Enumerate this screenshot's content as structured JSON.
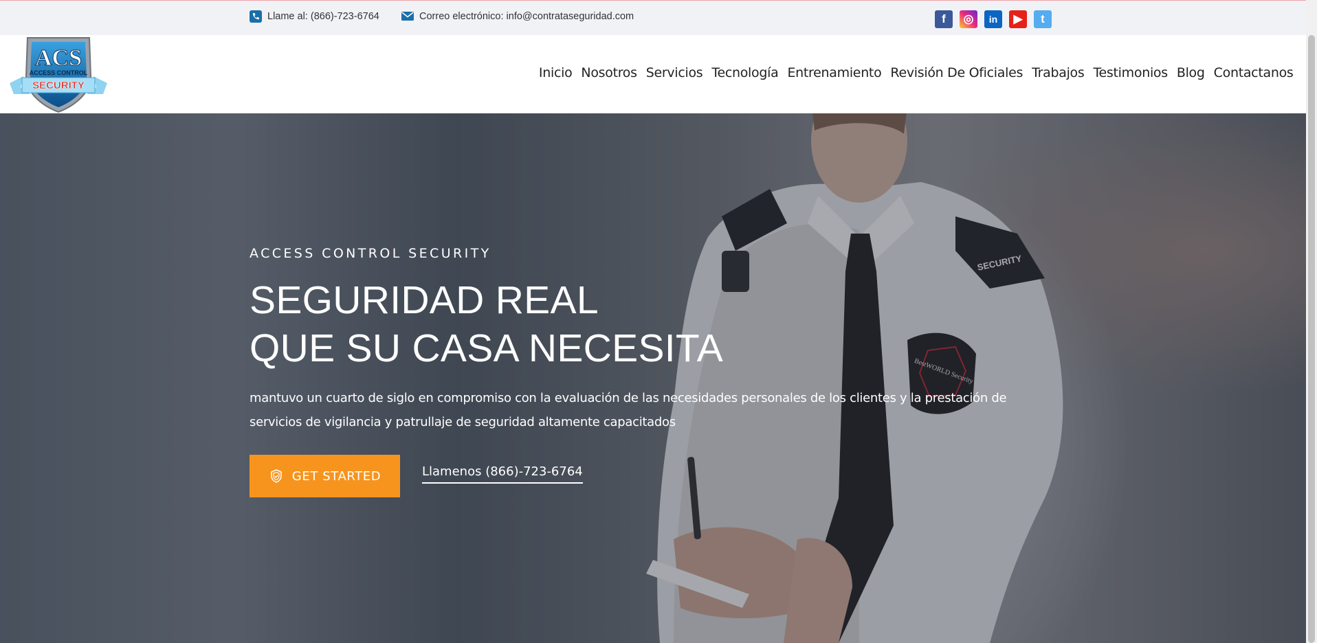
{
  "topbar": {
    "phone_text": "Llame al: (866)-723-6764",
    "email_text": "Correo electrónico: info@contrataseguridad.com",
    "social": [
      {
        "name": "facebook-icon",
        "glyph": "f"
      },
      {
        "name": "instagram-icon",
        "glyph": "◎"
      },
      {
        "name": "linkedin-icon",
        "glyph": "in"
      },
      {
        "name": "youtube-icon",
        "glyph": "▶"
      },
      {
        "name": "twitter-icon",
        "glyph": "t"
      }
    ]
  },
  "logo": {
    "text_big": "ACS",
    "text_line1": "ACCESS CONTROL",
    "text_line2": "SECURITY"
  },
  "nav": {
    "items": [
      "Inicio",
      "Nosotros",
      "Servicios",
      "Tecnología",
      "Entrenamiento",
      "Revisión De Oficiales",
      "Trabajos",
      "Testimonios",
      "Blog",
      "Contactanos"
    ]
  },
  "hero": {
    "eyebrow": "ACCESS CONTROL SECURITY",
    "title_line1": "SEGURIDAD REAL",
    "title_line2": "QUE SU CASA NECESITA",
    "description": "mantuvo un cuarto de siglo en compromiso con la evaluación de las necesidades personales de los clientes y la prestación de servicios de vigilancia y patrullaje de seguridad altamente capacitados",
    "cta_label": "GET STARTED",
    "call_label": "Llamenos (866)-723-6764",
    "badge_text": "SECURITY",
    "patch_text": "BestWORLD Security"
  },
  "colors": {
    "accent": "#f7941d",
    "topbar_bg": "#f1f2f6",
    "icon_blue": "#1a6fa8"
  }
}
